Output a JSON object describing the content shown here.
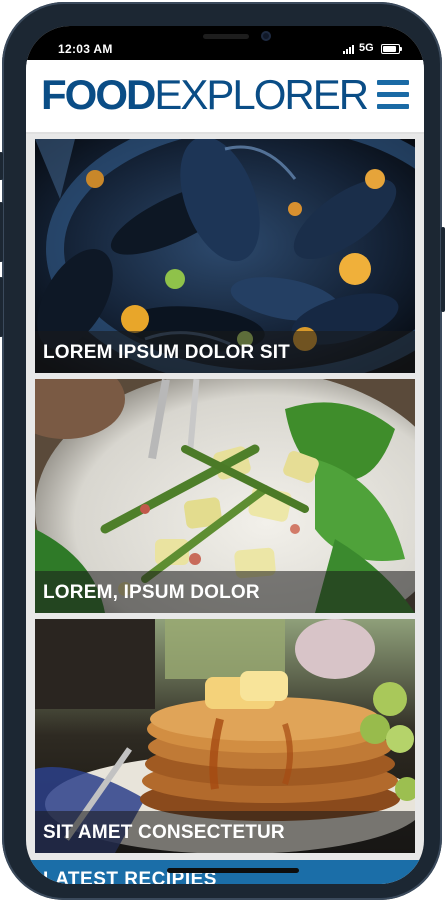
{
  "status_bar": {
    "time": "12:03 AM",
    "network": "5G"
  },
  "header": {
    "logo_bold": "FOOD",
    "logo_light": "EXPLORER",
    "menu_icon": "hamburger-menu-icon"
  },
  "cards": [
    {
      "caption": "LOREM IPSUM DOLOR SIT",
      "image": "mussels-dish"
    },
    {
      "caption": "LOREM, IPSUM DOLOR",
      "image": "potato-green-bean-salad"
    },
    {
      "caption": "SIT AMET CONSECTETUR",
      "image": "pancake-stack-with-syrup"
    }
  ],
  "latest_section": {
    "title": "LATEST RECIPIES"
  },
  "colors": {
    "brand": "#0a4d86",
    "accent": "#1b6ea8",
    "frame": "#1c2733"
  }
}
